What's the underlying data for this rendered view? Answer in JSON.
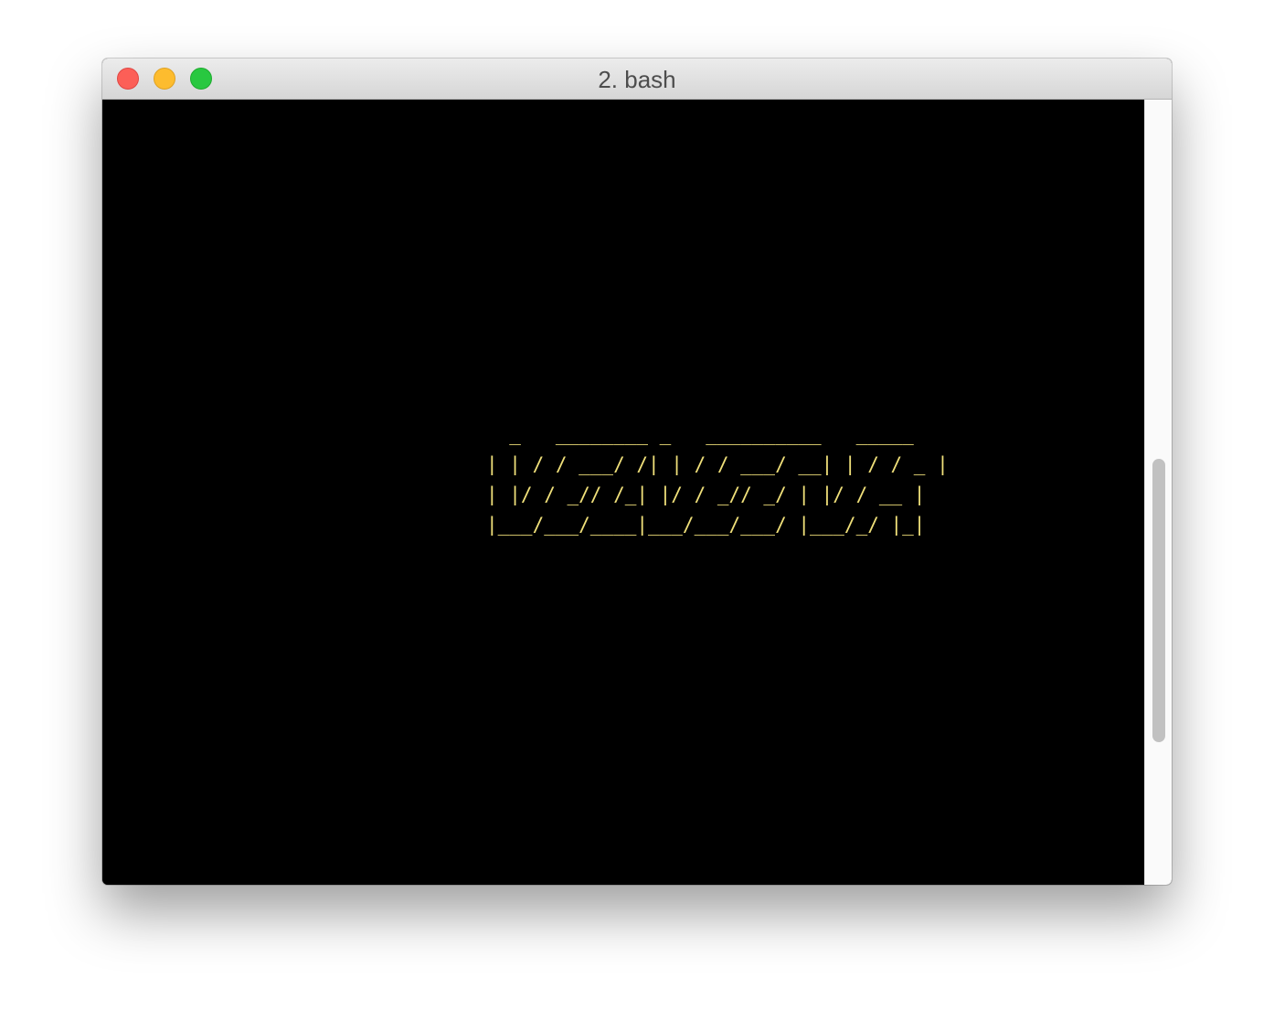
{
  "window": {
    "title": "2. bash"
  },
  "terminal": {
    "ascii_art": "  _   ________ _   __________   _____ \n| | / / ___/ /| | / / ___/ __| | / / _ |\n| |/ / _// /_| |/ / _// _/ | |/ / __ |\n|___/___/____|___/___/___/ |___/_/ |_|",
    "text_color": "#f0e07a",
    "background_color": "#000000"
  },
  "traffic_lights": {
    "close_icon": "close-icon",
    "minimize_icon": "minimize-icon",
    "zoom_icon": "zoom-icon"
  }
}
